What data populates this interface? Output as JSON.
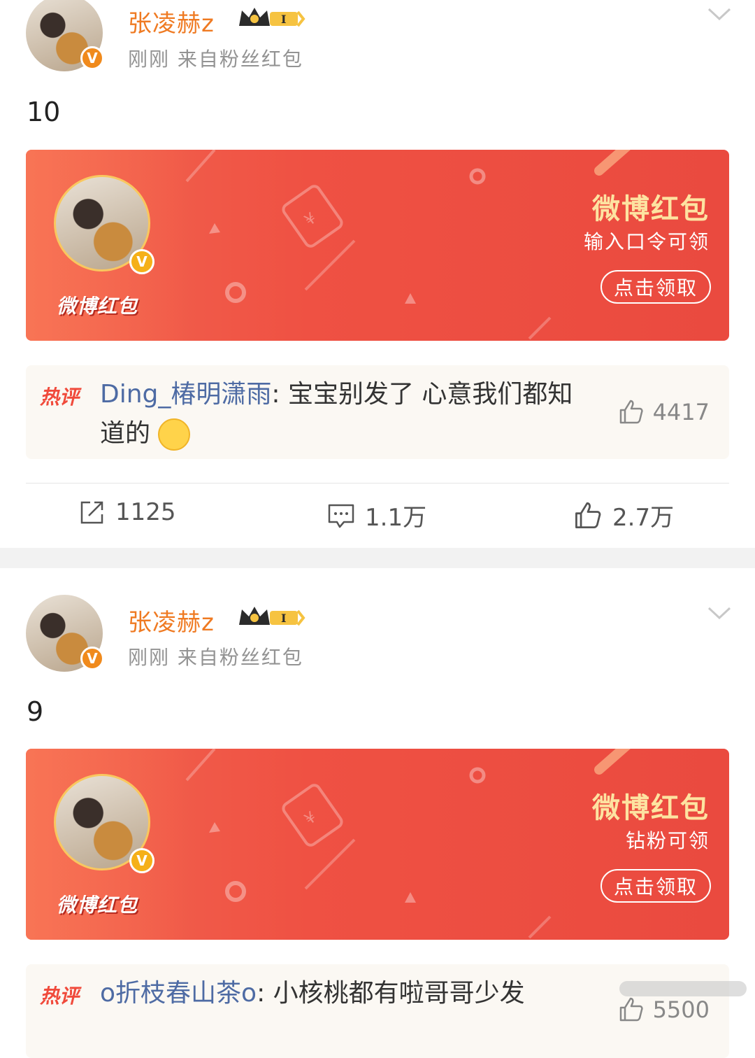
{
  "posts": [
    {
      "username": "张凌赫z",
      "level": "I",
      "meta": "刚刚  来自粉丝红包",
      "text": "10",
      "card": {
        "logo": "微博红包",
        "title": "微博红包",
        "subtitle": "输入口令可领",
        "button": "点击领取"
      },
      "hot_comment": {
        "tag": "热评",
        "author": "Ding_椿明潇雨",
        "sep": ": ",
        "text": "宝宝别发了 心意我们都知道的",
        "likes": "4417"
      },
      "actions": {
        "share": "1125",
        "comment": "1.1万",
        "like": "2.7万"
      }
    },
    {
      "username": "张凌赫z",
      "level": "I",
      "meta": "刚刚  来自粉丝红包",
      "text": "9",
      "card": {
        "logo": "微博红包",
        "title": "微博红包",
        "subtitle": "钻粉可领",
        "button": "点击领取"
      },
      "hot_comment": {
        "tag": "热评",
        "author": "o折枝春山茶o",
        "sep": ": ",
        "text": "小核桃都有啦哥哥少发",
        "likes": "5500"
      }
    }
  ],
  "colors": {
    "username": "#ef7a22",
    "card_red": "#ef5143",
    "card_title": "#fde3a1",
    "hot_tag": "#f04a3b",
    "comment_author": "#4e6ba4"
  }
}
